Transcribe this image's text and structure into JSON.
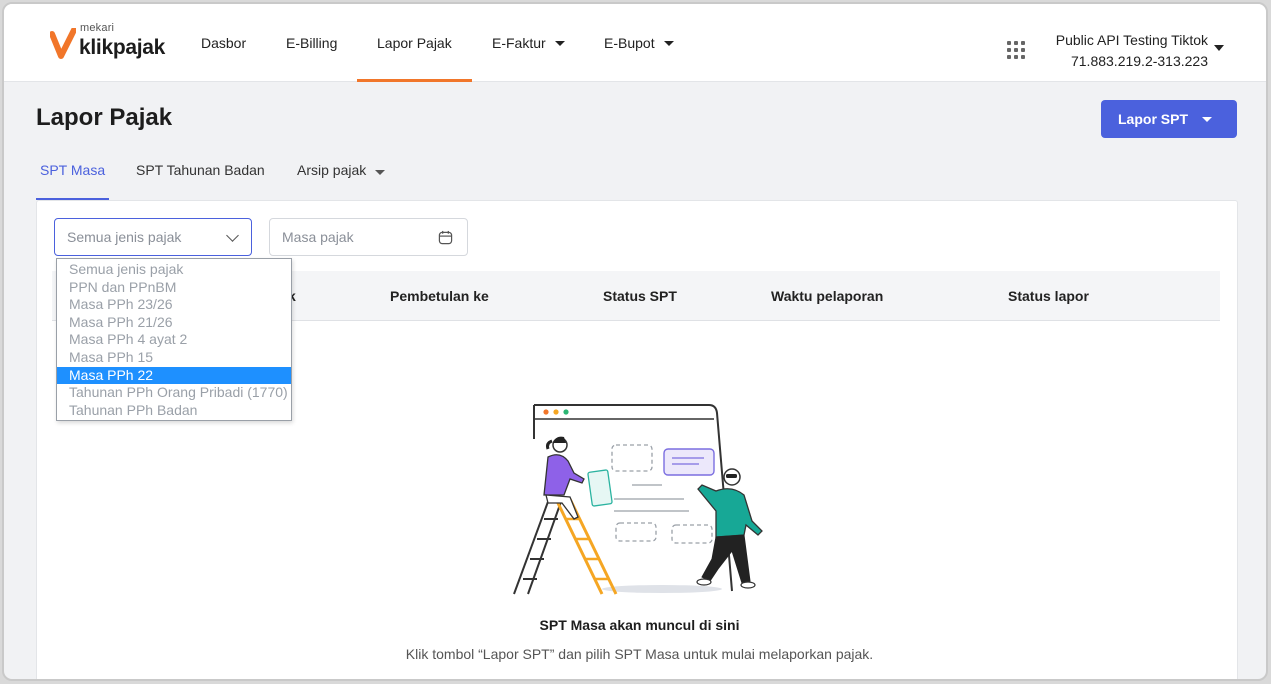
{
  "brand": {
    "small": "mekari",
    "name": "klikpajak",
    "accent": "#f1762a"
  },
  "nav": {
    "items": [
      {
        "label": "Dasbor"
      },
      {
        "label": "E-Billing"
      },
      {
        "label": "Lapor Pajak"
      },
      {
        "label": "E-Faktur"
      },
      {
        "label": "E-Bupot"
      }
    ],
    "active": "Lapor Pajak"
  },
  "account": {
    "name": "Public API Testing Tiktok",
    "npwp": "71.883.219.2-313.223"
  },
  "page": {
    "title": "Lapor Pajak",
    "lapor_button": "Lapor SPT",
    "primary_color": "#4b61dd"
  },
  "tabs": [
    {
      "label": "SPT Masa"
    },
    {
      "label": "SPT Tahunan Badan"
    },
    {
      "label": "Arsip pajak"
    }
  ],
  "filters": {
    "tax_type_value": "Semua jenis pajak",
    "tax_period_placeholder": "Masa pajak"
  },
  "dropdown": {
    "options": [
      "Semua jenis pajak",
      "PPN dan PPnBM",
      "Masa PPh 23/26",
      "Masa PPh 21/26",
      "Masa PPh 4 ayat 2",
      "Masa PPh 15",
      "Masa PPh 22",
      "Tahunan PPh Orang Pribadi (1770)",
      "Tahunan PPh Badan"
    ],
    "highlighted": "Masa PPh 22"
  },
  "table": {
    "headers": [
      "k",
      "Pembetulan ke",
      "Status SPT",
      "Waktu pelaporan",
      "Status lapor"
    ]
  },
  "empty_state": {
    "title": "SPT Masa akan muncul di sini",
    "description": "Klik tombol “Lapor SPT” dan pilih SPT Masa untuk mulai melaporkan pajak."
  }
}
